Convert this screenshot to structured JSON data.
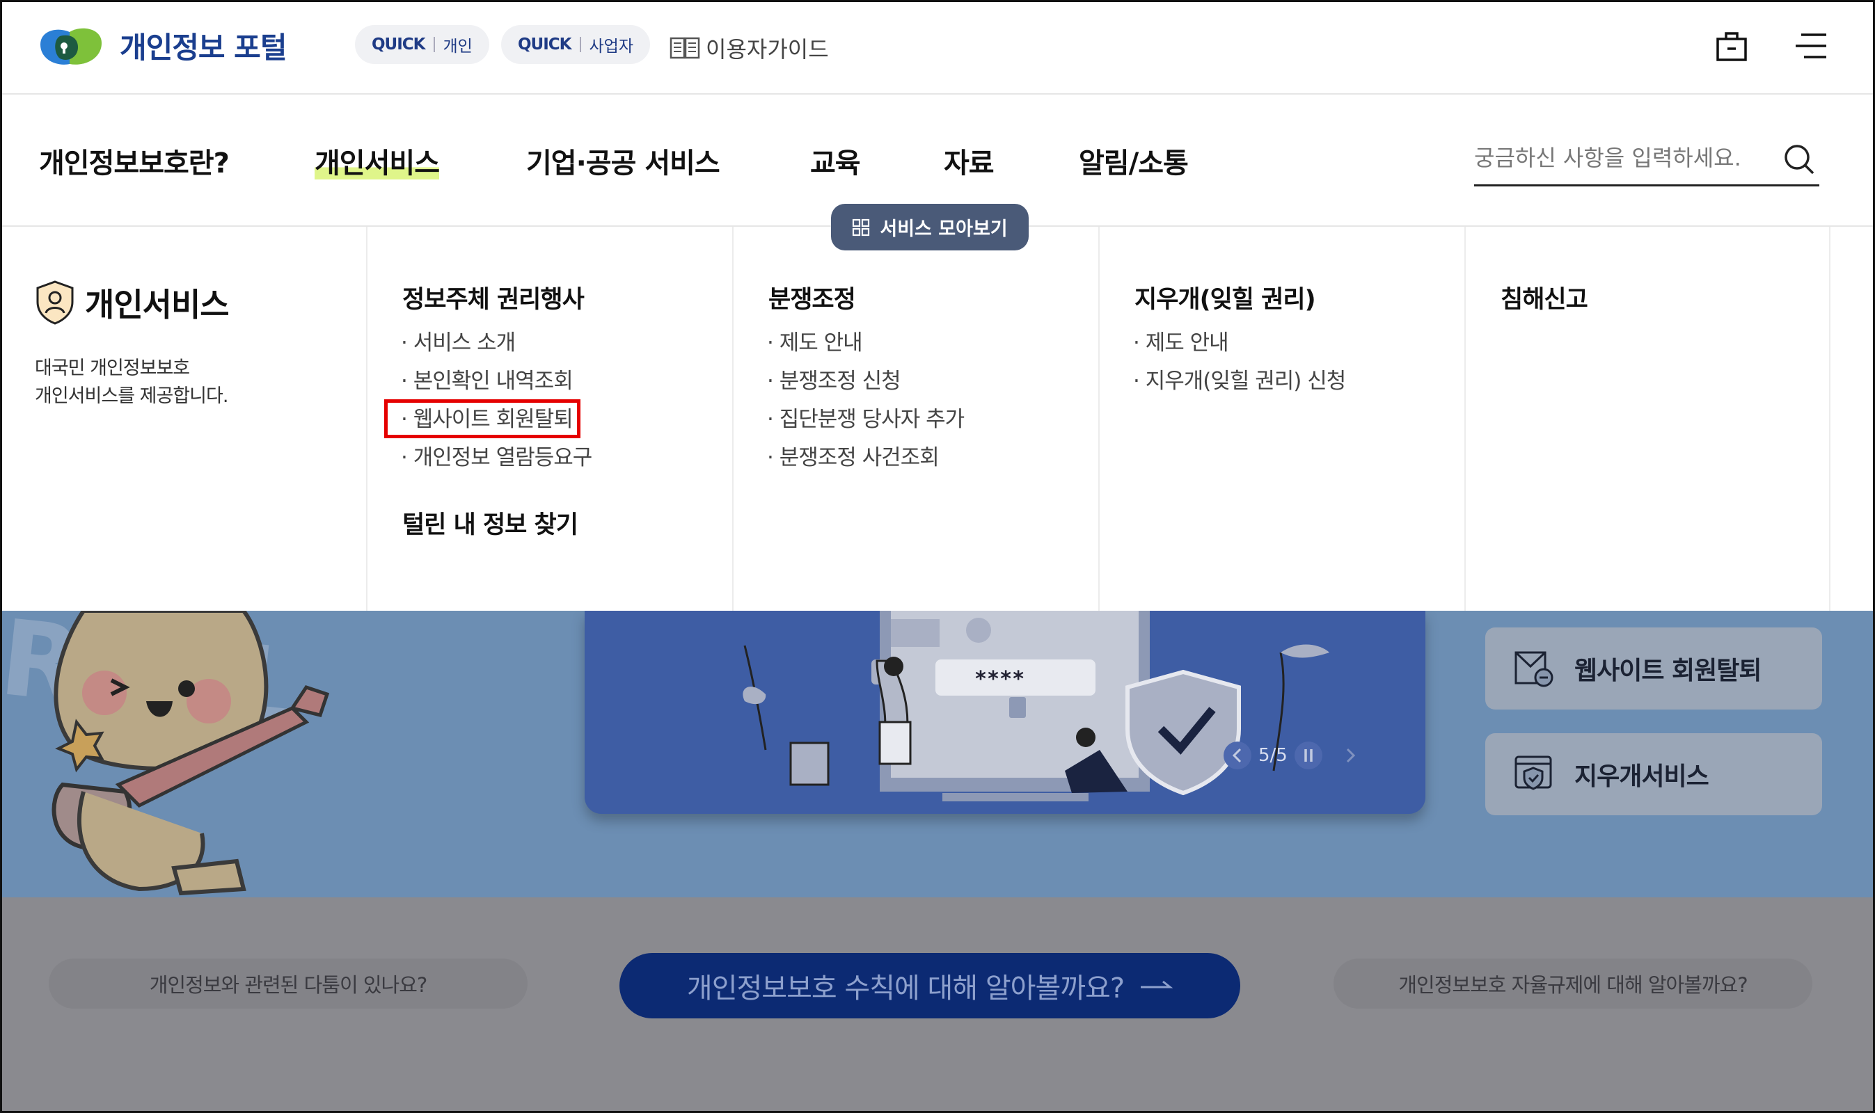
{
  "header": {
    "logo_text": "개인정보 포털",
    "quick_personal": {
      "tag": "QUICK",
      "label": "개인"
    },
    "quick_business": {
      "tag": "QUICK",
      "label": "사업자"
    },
    "guide_label": "이용자가이드",
    "icons": [
      "briefcase-icon",
      "menu-icon"
    ]
  },
  "nav": {
    "items": [
      "개인정보보호란?",
      "개인서비스",
      "기업·공공 서비스",
      "교육",
      "자료",
      "알림/소통"
    ],
    "active": "개인서비스",
    "search_placeholder": "궁금하신 사항을 입력하세요.",
    "collect_button": "서비스 모아보기"
  },
  "mega": {
    "intro_title": "개인서비스",
    "intro_desc_1": "대국민 개인정보보호",
    "intro_desc_2": "개인서비스를 제공합니다.",
    "columns": [
      {
        "title": "정보주체 권리행사",
        "items": [
          "서비스 소개",
          "본인확인 내역조회",
          "웹사이트 회원탈퇴",
          "개인정보 열람등요구"
        ],
        "sub_title": "털린 내 정보 찾기"
      },
      {
        "title": "분쟁조정",
        "items": [
          "제도 안내",
          "분쟁조정 신청",
          "집단분쟁 당사자 추가",
          "분쟁조정 사건조회"
        ]
      },
      {
        "title": "지우개(잊힐 권리)",
        "items": [
          "제도 안내",
          "지우개(잊힐 권리) 신청"
        ]
      },
      {
        "title": "침해신고",
        "items": []
      }
    ]
  },
  "hero": {
    "banner_password": "****",
    "pager": "5/5",
    "side_cards": [
      "웹사이트 회원탈퇴",
      "지우개서비스"
    ]
  },
  "bottom": {
    "left_pill": "개인정보와 관련된 다툼이 있나요?",
    "main_pill": "개인정보보호 수칙에 대해 알아볼까요?",
    "right_pill": "개인정보보호 자율규제에 대해 알아볼까요?"
  },
  "colors": {
    "brand": "#1a3e8e",
    "accent_highlight": "#dff58a",
    "banner": "#3e5da4",
    "selection_box": "#e50000"
  }
}
